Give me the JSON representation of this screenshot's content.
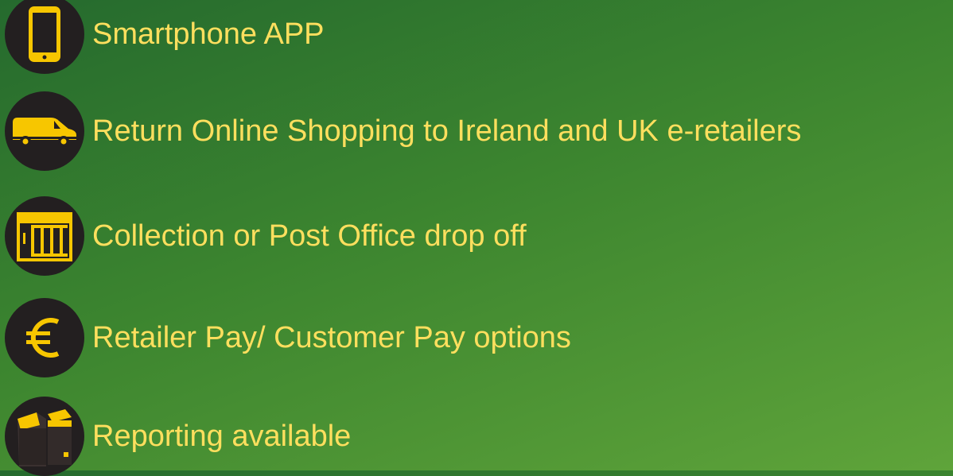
{
  "accent_color": "#ffdf5e",
  "icon_color": "#f7c600",
  "badge_color": "#231f20",
  "features": [
    {
      "icon": "smartphone-icon",
      "label": "Smartphone APP"
    },
    {
      "icon": "van-icon",
      "label": "Return Online Shopping to Ireland and UK e-retailers"
    },
    {
      "icon": "shop-front-icon",
      "label": "Collection or Post Office drop off"
    },
    {
      "icon": "euro-icon",
      "label": "Retailer Pay/ Customer Pay options"
    },
    {
      "icon": "parcel-boxes-icon",
      "label": "Reporting available"
    }
  ]
}
